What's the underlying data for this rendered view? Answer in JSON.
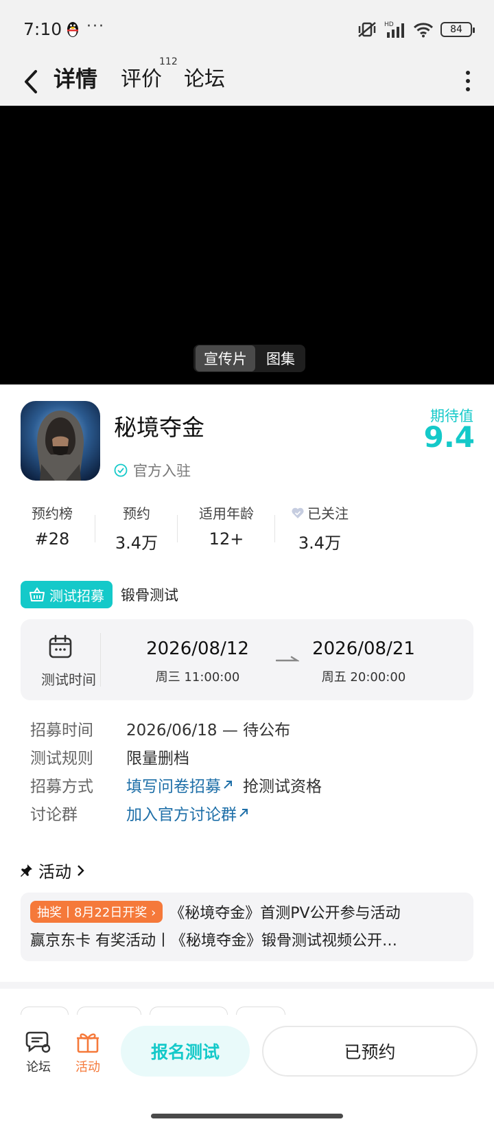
{
  "status_bar": {
    "time": "7:10",
    "dots": "···",
    "battery": "84",
    "network": "HD"
  },
  "nav": {
    "tabs": [
      {
        "label": "详情",
        "active": true
      },
      {
        "label": "评价",
        "badge": "112"
      },
      {
        "label": "论坛"
      }
    ]
  },
  "video": {
    "tabs": [
      {
        "label": "宣传片",
        "active": true
      },
      {
        "label": "图集"
      }
    ]
  },
  "game": {
    "title": "秘境夺金",
    "official": "官方入驻",
    "expect_label": "期待值",
    "expect_score": "9.4"
  },
  "stats": [
    {
      "label": "预约榜",
      "value": "#28"
    },
    {
      "label": "预约",
      "value": "3.4万"
    },
    {
      "label": "适用年龄",
      "value": "12+"
    },
    {
      "label": "已关注",
      "value": "3.4万"
    }
  ],
  "recruit": {
    "badge": "测试招募",
    "name": "锻骨测试"
  },
  "test_time": {
    "label": "测试时间",
    "start_date": "2026/08/12",
    "start_sub": "周三  11:00:00",
    "end_date": "2026/08/21",
    "end_sub": "周五  20:00:00"
  },
  "details": {
    "recruit_time": {
      "key": "招募时间",
      "value": "2026/06/18 — 待公布"
    },
    "rules": {
      "key": "测试规则",
      "value": "限量删档"
    },
    "method": {
      "key": "招募方式",
      "link": "填写问卷招募",
      "extra": "抢测试资格"
    },
    "group": {
      "key": "讨论群",
      "link": "加入官方讨论群"
    }
  },
  "activity": {
    "heading": "活动",
    "badge": "抽奖丨8月22日开奖 ›",
    "line1": "《秘境夺金》首测PV公开参与活动",
    "line2": "赢京东卡 有奖活动丨《秘境夺金》锻骨测试视频公开…"
  },
  "bottom": {
    "forum": "论坛",
    "activity": "活动",
    "signup": "报名测试",
    "reserved": "已预约"
  },
  "colors": {
    "accent": "#14c9c9",
    "orange": "#f5793a",
    "link": "#1e6fa8"
  }
}
